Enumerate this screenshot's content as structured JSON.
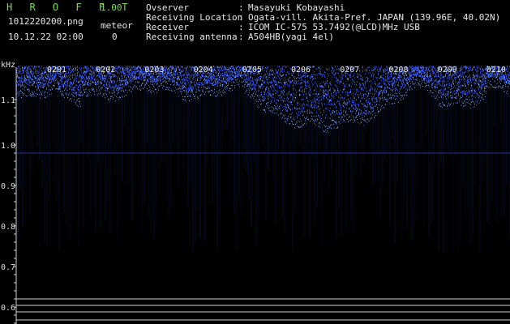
{
  "app": {
    "name": "H R O F F T",
    "version": "1.00"
  },
  "file": {
    "name": "1012220200.png",
    "datetime": "10.12.22 02:00"
  },
  "meteor": {
    "label": "meteor",
    "count": "0"
  },
  "info": [
    {
      "key": "Ovserver",
      "value": "Masayuki Kobayashi"
    },
    {
      "key": "Receiving Location",
      "value": "Ogata-vill. Akita-Pref. JAPAN (139.96E, 40.02N)"
    },
    {
      "key": "Receiver",
      "value": "ICOM IC-575 53.7492(@LCD)MHz USB"
    },
    {
      "key": "Receiving antenna",
      "value": "A504HB(yagi 4el)"
    }
  ],
  "info_sep": ":",
  "plot": {
    "y_unit": "kHz",
    "y_ticks": [
      "1.1",
      "1.0",
      "0.9",
      "0.8",
      "0.7",
      "0.6"
    ],
    "time_labels": [
      "0201",
      "0202",
      "0203",
      "0204",
      "0205",
      "0206",
      "0207",
      "0208",
      "0209",
      "0210"
    ],
    "colors": {
      "trace": "#3a5cff",
      "trace_bright": "#7fb0ff",
      "axis": "#d0d0d0",
      "bg": "#000000"
    }
  }
}
